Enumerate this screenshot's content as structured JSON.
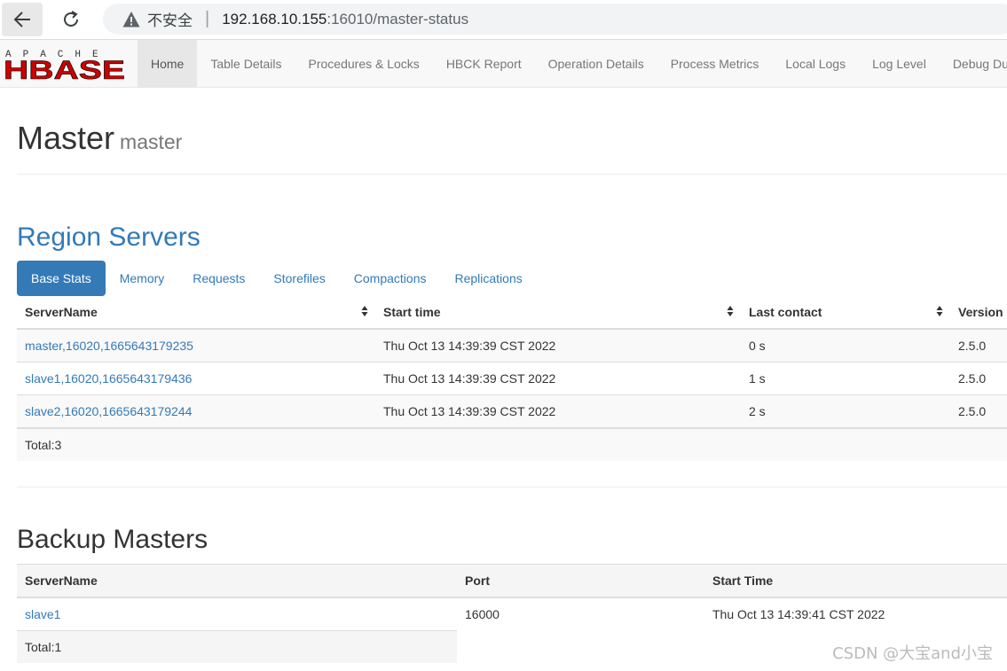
{
  "browser": {
    "security_label": "不安全",
    "url_host": "192.168.10.155",
    "url_rest": ":16010/master-status"
  },
  "navbar": {
    "logo_text": "APACHE HBASE",
    "items": [
      {
        "label": "Home",
        "active": true
      },
      {
        "label": "Table Details"
      },
      {
        "label": "Procedures & Locks"
      },
      {
        "label": "HBCK Report"
      },
      {
        "label": "Operation Details"
      },
      {
        "label": "Process Metrics"
      },
      {
        "label": "Local Logs"
      },
      {
        "label": "Log Level"
      },
      {
        "label": "Debug Du"
      }
    ]
  },
  "header": {
    "title": "Master",
    "subtitle": "master"
  },
  "region_servers": {
    "title": "Region Servers",
    "tabs": [
      "Base Stats",
      "Memory",
      "Requests",
      "Storefiles",
      "Compactions",
      "Replications"
    ],
    "columns": [
      "ServerName",
      "Start time",
      "Last contact",
      "Version"
    ],
    "rows": [
      {
        "server": "master,16020,1665643179235",
        "start": "Thu Oct 13 14:39:39 CST 2022",
        "contact": "0 s",
        "version": "2.5.0"
      },
      {
        "server": "slave1,16020,1665643179436",
        "start": "Thu Oct 13 14:39:39 CST 2022",
        "contact": "1 s",
        "version": "2.5.0"
      },
      {
        "server": "slave2,16020,1665643179244",
        "start": "Thu Oct 13 14:39:39 CST 2022",
        "contact": "2 s",
        "version": "2.5.0"
      }
    ],
    "total": "Total:3"
  },
  "backup_masters": {
    "title": "Backup Masters",
    "columns": [
      "ServerName",
      "Port",
      "Start Time"
    ],
    "rows": [
      {
        "server": "slave1",
        "port": "16000",
        "start": "Thu Oct 13 14:39:41 CST 2022"
      }
    ],
    "total": "Total:1"
  },
  "watermark": "CSDN @大宝and小宝"
}
